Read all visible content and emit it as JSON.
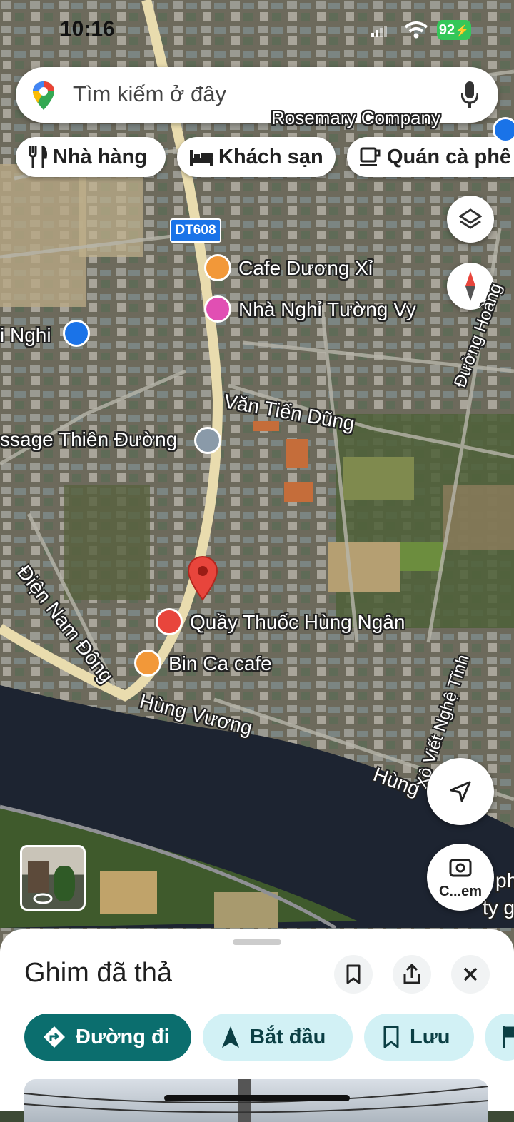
{
  "status": {
    "time": "10:16",
    "battery": "92"
  },
  "search": {
    "placeholder": "Tìm kiếm ở đây"
  },
  "chips": [
    {
      "label": "Nhà hàng",
      "icon": "fork-knife-icon"
    },
    {
      "label": "Khách sạn",
      "icon": "bed-icon"
    },
    {
      "label": "Quán cà phê",
      "icon": "coffee-cup-icon"
    }
  ],
  "map": {
    "road_shield": "DT608",
    "places": [
      {
        "name": "Cafe Dương Xỉ",
        "icon": "coffee-icon",
        "color": "#f29839"
      },
      {
        "name": "Nhà Nghỉ Tường Vy",
        "icon": "hotel-icon",
        "color": "#e14fb3"
      },
      {
        "name": "i Nghi",
        "icon": "shopping-cart-icon",
        "color": "#1a73e8"
      },
      {
        "name": "ssage Thiên Đường",
        "icon": "location-icon",
        "color": "#8a9aa9"
      },
      {
        "name": "Quầy Thuốc Hùng Ngân",
        "icon": "pharmacy-icon",
        "color": "#e8453c"
      },
      {
        "name": "Bin Ca cafe",
        "icon": "coffee-icon",
        "color": "#f29839"
      }
    ],
    "streets": [
      "Văn Tiến Dũng",
      "Điện Nam Đông",
      "Hùng Vương",
      "Xô Viết Nghệ Tĩnh",
      "Hùng",
      "Đường Hoàng",
      "Rosemary Company",
      "ph",
      "ty g"
    ],
    "lens_label": "C...em",
    "dropped_pin_color": "#e8453c"
  },
  "sheet": {
    "title": "Ghim đã thả",
    "actions": [
      {
        "label": "Đường đi",
        "icon": "directions-icon"
      },
      {
        "label": "Bắt đầu",
        "icon": "navigation-arrow-icon"
      },
      {
        "label": "Lưu",
        "icon": "bookmark-icon"
      }
    ]
  },
  "colors": {
    "primary_action": "#0b6e6e",
    "secondary_action": "#d2f1f5",
    "accent_blue": "#1a73e8"
  }
}
